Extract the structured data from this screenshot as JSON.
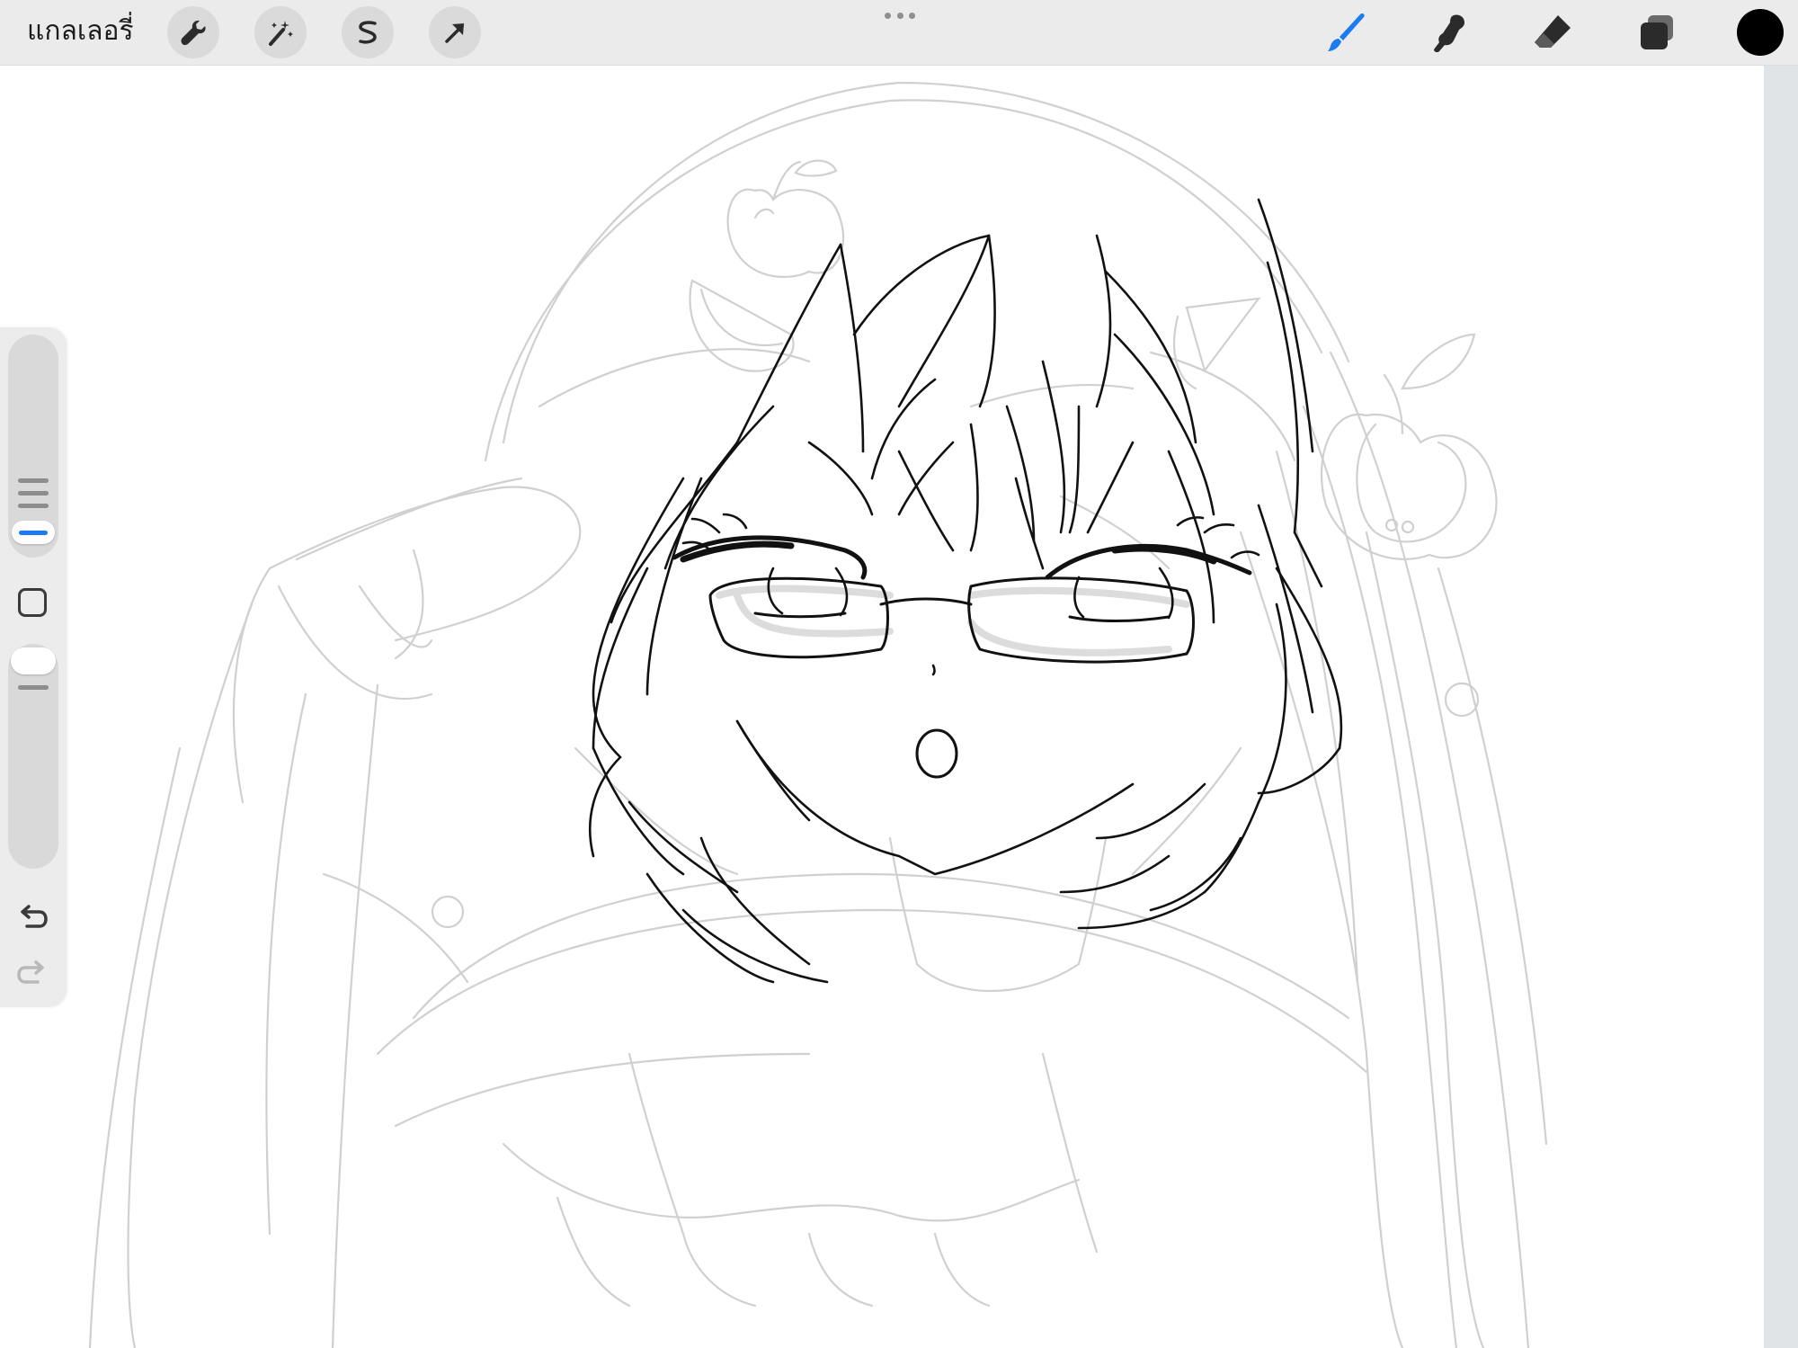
{
  "toolbar": {
    "gallery_label": "แกลเลอรี่",
    "left_tools": [
      {
        "name": "actions",
        "icon": "wrench-icon"
      },
      {
        "name": "adjustments",
        "icon": "magic-wand-icon"
      },
      {
        "name": "selection",
        "icon": "selection-s-icon"
      },
      {
        "name": "transform",
        "icon": "arrow-cursor-icon"
      }
    ],
    "right_tools": [
      {
        "name": "brush",
        "icon": "brush-icon",
        "active": true
      },
      {
        "name": "smudge",
        "icon": "smudge-icon",
        "active": false
      },
      {
        "name": "eraser",
        "icon": "eraser-icon",
        "active": false
      },
      {
        "name": "layers",
        "icon": "layers-icon",
        "active": false
      }
    ],
    "current_color": "#000000"
  },
  "sidebar": {
    "brush_size_level": 0.15,
    "brush_opacity_level": 1.0,
    "modify_icon": "square-icon",
    "undo_icon": "undo-icon",
    "redo_icon": "redo-icon"
  },
  "colors": {
    "accent": "#1a7bf2",
    "toolbar_bg": "#ebebeb",
    "sidebar_bg": "#ececec",
    "ink": "#111111",
    "sketch": "#cfcfcf"
  }
}
